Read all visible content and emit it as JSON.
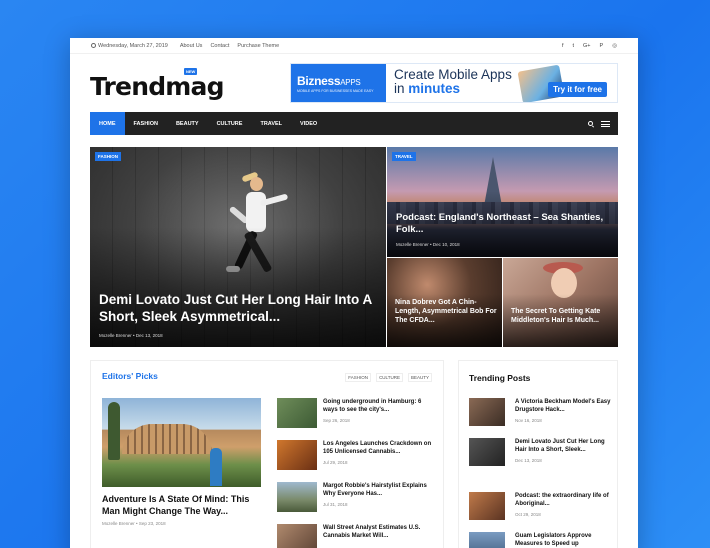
{
  "topbar": {
    "date": "Wednesday, March 27, 2019",
    "links": [
      "About Us",
      "Contact",
      "Purchase Theme"
    ],
    "socials": [
      "f",
      "t",
      "G+",
      "P",
      "◎"
    ]
  },
  "logo": {
    "text": "Trendmag",
    "badge": "NEW"
  },
  "banner": {
    "brand": "Bizness",
    "brand_suffix": "APPS",
    "tagline": "MOBILE APPS FOR BUSINESSES MADE EASY",
    "line1": "Create Mobile Apps",
    "line2_prefix": "in",
    "line2_highlight": "minutes",
    "cta": "Try it for free"
  },
  "nav": {
    "items": [
      "HOME",
      "FASHION",
      "BEAUTY",
      "CULTURE",
      "TRAVEL",
      "VIDEO"
    ]
  },
  "featured": [
    {
      "tag": "FASHION",
      "title": "Demi Lovato Just Cut Her Long Hair Into A Short, Sleek Asymmetrical...",
      "meta": "Mozelle Brenner  •  Dec 13, 2018"
    },
    {
      "tag": "TRAVEL",
      "title": "Podcast: England's Northeast – Sea Shanties, Folk...",
      "meta": "Mozelle Brenner  •  Dec 10, 2018"
    },
    {
      "title": "Nina Dobrev Got A Chin-Length, Asymmetrical Bob For The CFDA..."
    },
    {
      "title": "The Secret To Getting Kate Middleton's Hair Is Much..."
    }
  ],
  "editors": {
    "title": "Editors' Picks",
    "filters": [
      "FASHION",
      "CULTURE",
      "BEAUTY"
    ],
    "main": {
      "title": "Adventure Is A State Of Mind: This Man Might Change The Way...",
      "meta": "Mozelle Brenner  •  Sep 23, 2018"
    },
    "items": [
      {
        "title": "Going underground in Hamburg: 6 ways to see the city's...",
        "date": "Sep 26, 2018"
      },
      {
        "title": "Los Angeles Launches Crackdown on 105 Unlicensed Cannabis...",
        "date": "Jul 29, 2018"
      },
      {
        "title": "Margot Robbie's Hairstylist Explains Why Everyone Has...",
        "date": "Jul 31, 2018"
      },
      {
        "title": "Wall Street Analyst Estimates U.S. Cannabis Market Will...",
        "date": ""
      }
    ]
  },
  "trending": {
    "title": "Trending Posts",
    "items": [
      {
        "title": "A Victoria Beckham Model's Easy Drugstore Hack...",
        "date": "Nov 16, 2018"
      },
      {
        "title": "Demi Lovato Just Cut Her Long Hair Into a Short, Sleek...",
        "date": "Dec 13, 2018"
      },
      {
        "title": "Podcast: the extraordinary life of Aboriginal...",
        "date": "Oct 29, 2018"
      },
      {
        "title": "Guam Legislators Approve Measures to Speed up",
        "date": ""
      }
    ]
  },
  "colors": {
    "accent": "#1e73e8",
    "nav_bg": "#222222",
    "page_bg": "#2a86f2"
  }
}
